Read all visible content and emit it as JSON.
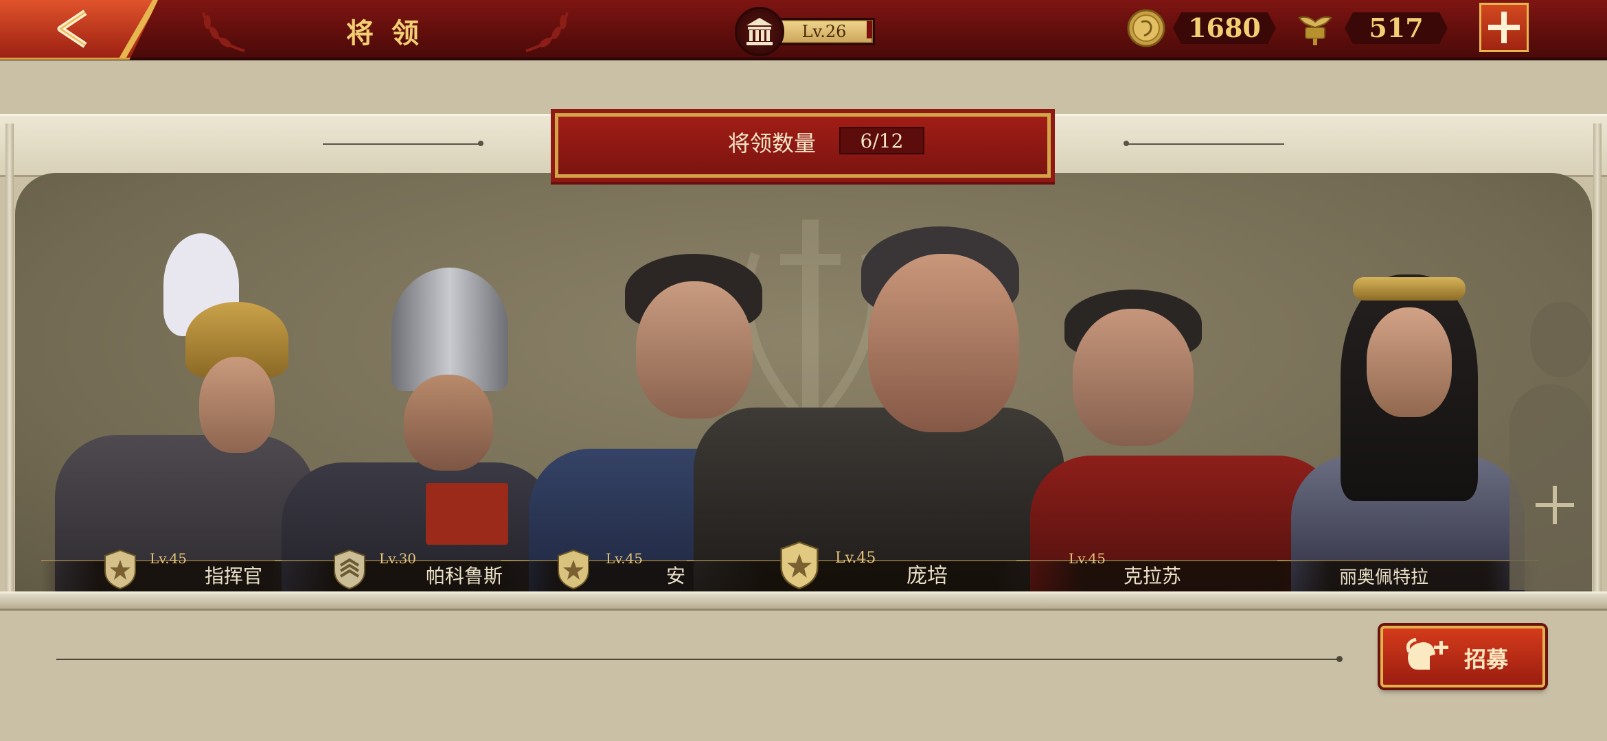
{
  "header": {
    "title": "将 领",
    "back_icon": "chevron-left-icon",
    "level_icon": "temple-icon",
    "level_label": "Lv.26",
    "coins": "1680",
    "coin_icon": "gold-coin-icon",
    "spqr": "517",
    "spqr_icon": "spqr-eagle-icon",
    "add_icon": "plus-icon"
  },
  "banner": {
    "label": "将领数量",
    "count": "6/12"
  },
  "heroes": [
    {
      "level": "Lv.45",
      "name": "指挥官"
    },
    {
      "level": "Lv.30",
      "name": "帕科鲁斯"
    },
    {
      "level": "Lv.45",
      "name": "安"
    },
    {
      "level": "Lv.45",
      "name": "庞培"
    },
    {
      "level": "Lv.45",
      "name": "克拉苏"
    },
    {
      "level": "",
      "name": "丽奥佩特拉"
    }
  ],
  "recruit": {
    "label": "招募",
    "icon": "helmet-plus-icon"
  },
  "colors": {
    "topbar": "#6e1210",
    "accent_gold": "#f2cf73",
    "panel_bg": "#c9c0a6",
    "stage_bg": "#7a7259",
    "button_red": "#b82a14"
  }
}
